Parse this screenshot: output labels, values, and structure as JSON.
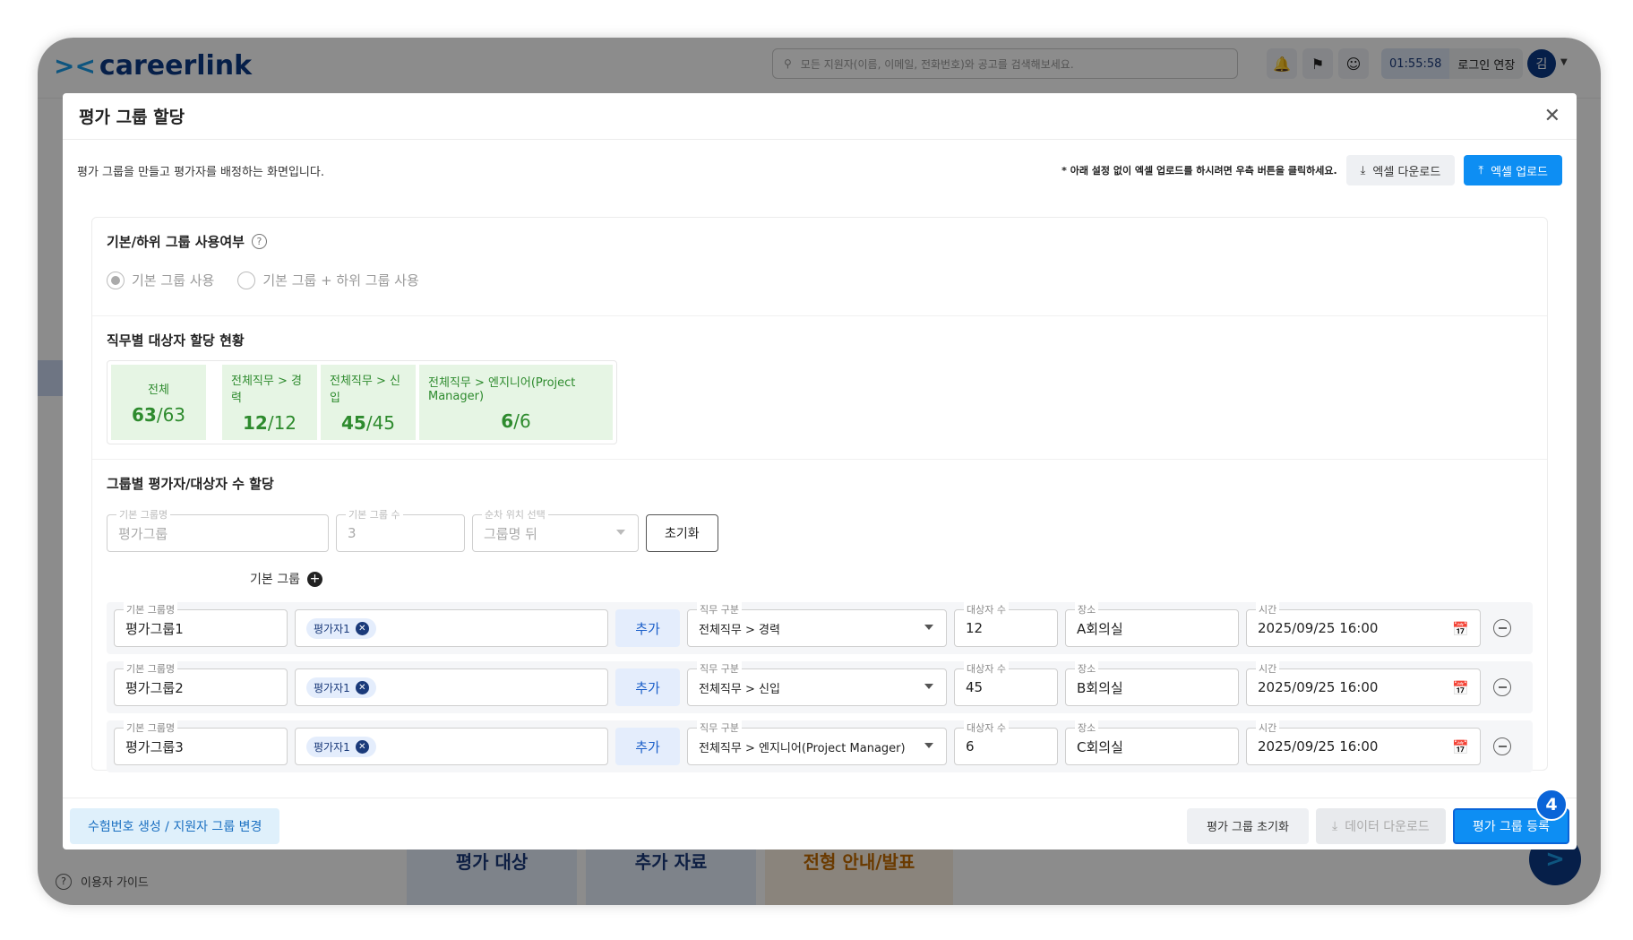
{
  "background": {
    "logo_text": "careerlink",
    "search_placeholder": "모든 지원자(이름, 이메일, 전화번호)와 공고를 검색해보세요.",
    "timer": "01:55:58",
    "extend_login": "로그인 연장",
    "avatar": "김",
    "user_guide": "이용자 가이드",
    "tabs": [
      "평가 대상",
      "추가 자료",
      "전형 안내/발표"
    ],
    "colors": {
      "brand": "#0b3a86",
      "accent": "#1a9be8"
    }
  },
  "modal": {
    "title": "평가 그룹 할당",
    "description": "평가 그룹을 만들고 평가자를 배정하는 화면입니다.",
    "excel_note": "* 아래 설정 없이 엑셀 업로드를 하시려면 우측 버튼을 클릭하세요.",
    "excel_download": "엑셀 다운로드",
    "excel_upload": "엑셀 업로드",
    "usage": {
      "title": "기본/하위 그룹 사용여부",
      "option_basic": "기본 그룹 사용",
      "option_sub": "기본 그룹 + 하위 그룹 사용",
      "selected": "기본 그룹 사용"
    },
    "status": {
      "title": "직무별 대상자 할당 현황",
      "items": [
        {
          "label": "전체",
          "assigned": "63",
          "total": "/63"
        },
        {
          "label": "전체직무 > 경력",
          "assigned": "12",
          "total": "/12"
        },
        {
          "label": "전체직무 > 신입",
          "assigned": "45",
          "total": "/45"
        },
        {
          "label": "전체직무 > 엔지니어(Project Manager)",
          "assigned": "6",
          "total": "/6"
        }
      ]
    },
    "assign": {
      "title": "그룹별 평가자/대상자 수 할당",
      "group_name_label": "기본 그룹명",
      "group_name_value": "평가그룹",
      "group_count_label": "기본 그룹 수",
      "group_count_value": "3",
      "order_label": "순차 위치 선택",
      "order_value": "그룹명 뒤",
      "reset": "초기화",
      "basic_group": "기본 그룹"
    },
    "row_labels": {
      "name": "기본 그룹명",
      "job": "직무 구분",
      "count": "대상자 수",
      "place": "장소",
      "time": "시간",
      "add": "추가"
    },
    "groups": [
      {
        "name": "평가그룹1",
        "evaluator": "평가자1",
        "job": "전체직무 > 경력",
        "count": "12",
        "place": "A회의실",
        "time": "2025/09/25 16:00"
      },
      {
        "name": "평가그룹2",
        "evaluator": "평가자1",
        "job": "전체직무 > 신입",
        "count": "45",
        "place": "B회의실",
        "time": "2025/09/25 16:00"
      },
      {
        "name": "평가그룹3",
        "evaluator": "평가자1",
        "job": "전체직무 > 엔지니어(Project Manager)",
        "count": "6",
        "place": "C회의실",
        "time": "2025/09/25 16:00"
      }
    ],
    "footer": {
      "exam_number": "수험번호 생성 / 지원자 그룹 변경",
      "reset_group": "평가 그룹 초기화",
      "data_download": "데이터 다운로드",
      "register": "평가 그룹 등록",
      "step_badge": "4"
    },
    "colors": {
      "primary": "#0d8ef3",
      "success": "#2e8b2e",
      "success_bg": "#e6f5e4"
    }
  }
}
